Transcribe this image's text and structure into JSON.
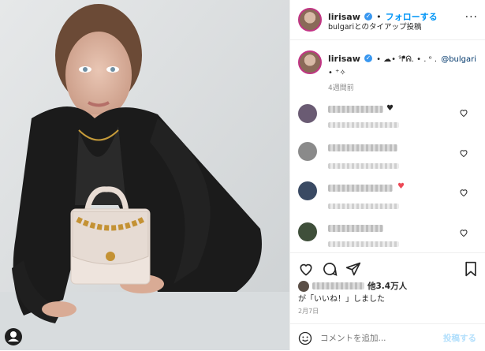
{
  "header": {
    "username": "lirisaw",
    "follow_label": "フォローする",
    "subtitle": "bulgariとのタイアップ投稿"
  },
  "caption": {
    "username": "lirisaw",
    "text": "• ☁︎• ⁹ᖰᕱ. • . ᵒ .",
    "mention": "@bulgari",
    "text2": "• ⁺✧",
    "time": "4週間前"
  },
  "comments": [
    {
      "emoji": "♥",
      "avatar_color": "#6a5b73"
    },
    {
      "emoji": "",
      "avatar_color": "#8a8a8a"
    },
    {
      "emoji": "♥",
      "avatar_color": "#3a4a63"
    },
    {
      "emoji": "",
      "avatar_color": "#3f4f3a"
    }
  ],
  "likes": {
    "prefix_blur": "",
    "count_text": "他3.4万人",
    "line2": "が「いいね！」しました"
  },
  "date": "2月7日",
  "comment_input": {
    "placeholder": "コメントを追加...",
    "post_label": "投稿する"
  },
  "colors": {
    "accent": "#0095f6",
    "verified": "#3897f0"
  }
}
